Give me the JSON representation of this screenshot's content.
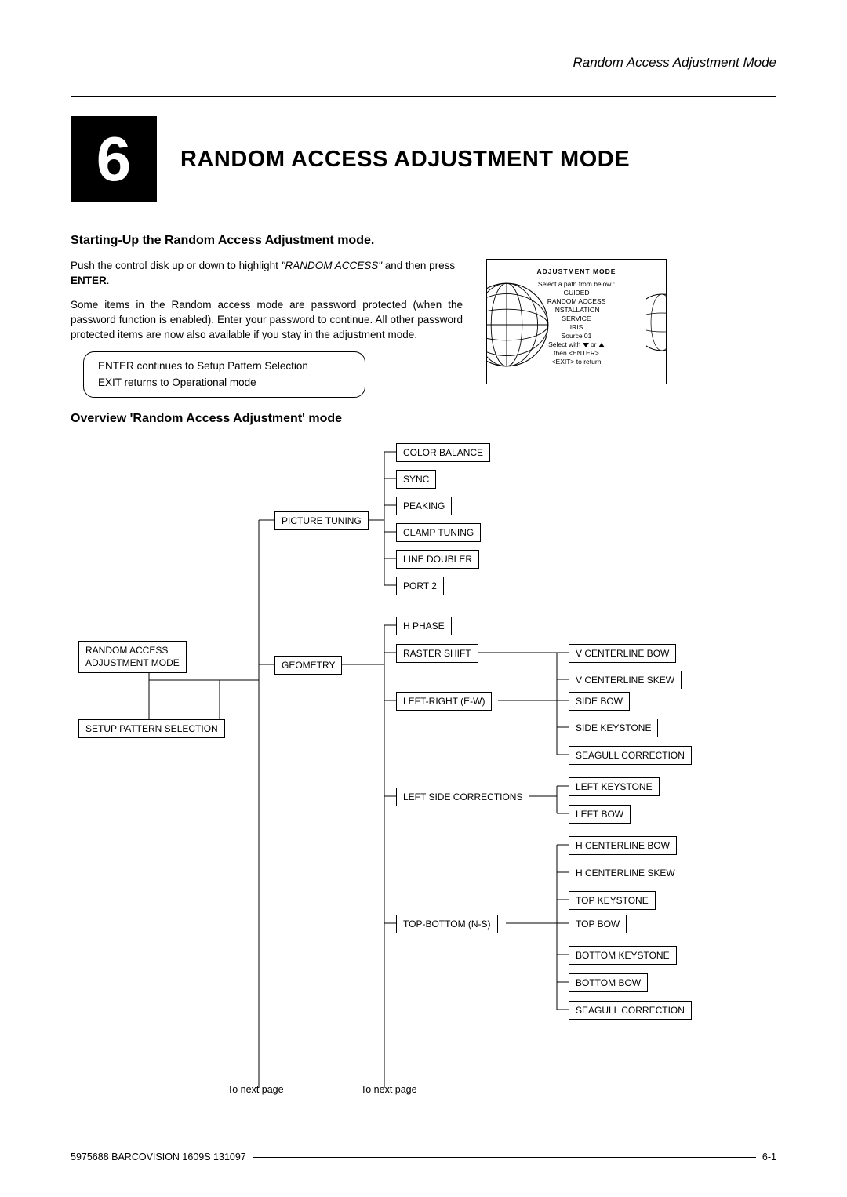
{
  "header": {
    "section": "Random Access Adjustment Mode"
  },
  "chapter": {
    "number": "6",
    "title": "RANDOM ACCESS ADJUSTMENT MODE"
  },
  "sections": {
    "start_h": "Starting-Up the Random Access Adjustment mode.",
    "overview_h": "Overview 'Random Access Adjustment' mode"
  },
  "body": {
    "p1a": "Push the control disk up or down to highlight ",
    "p1i": "\"RANDOM  ACCESS\"",
    "p1b": "  and then press ",
    "p1bold": "ENTER",
    "p1end": ".",
    "p2": "Some items in the Random access mode are password protected (when the password function is enabled).  Enter your password to continue.  All other password protected items are now also available if you stay in the adjustment mode."
  },
  "hint": {
    "l1b": "ENTER",
    "l1": " continues to Setup Pattern Selection",
    "l2b": "EXIT",
    "l2": " returns to Operational mode"
  },
  "screen": {
    "title": "ADJUSTMENT MODE",
    "sub": "Select  a  path  from  below :",
    "m1": "GUIDED",
    "m2": "RANDOM  ACCESS",
    "m3": "INSTALLATION",
    "m4": "SERVICE",
    "m5": "IRIS",
    "src": "Source  01",
    "sel_a": "Select with ",
    "sel_b": " or ",
    "then": "then  <ENTER>",
    "exit": "<EXIT>  to  return"
  },
  "diagram": {
    "root1": "RANDOM ACCESS",
    "root2": "ADJUSTMENT MODE",
    "setup": "SETUP PATTERN SELECTION",
    "pic": "PICTURE TUNING",
    "geo": "GEOMETRY",
    "pic_items": {
      "cb": "COLOR BALANCE",
      "sync": "SYNC",
      "peak": "PEAKING",
      "clamp": "CLAMP TUNING",
      "ld": "LINE DOUBLER",
      "p2": "PORT 2"
    },
    "geo_items": {
      "hp": "H PHASE",
      "rs": "RASTER SHIFT",
      "lr": "LEFT-RIGHT (E-W)",
      "lsc": "LEFT SIDE CORRECTIONS",
      "tb": "TOP-BOTTOM (N-S)"
    },
    "lr_items": {
      "vcb": "V CENTERLINE BOW",
      "vcs": "V CENTERLINE SKEW",
      "sb": "SIDE BOW",
      "sk": "SIDE KEYSTONE",
      "sc": "SEAGULL CORRECTION"
    },
    "lsc_items": {
      "lk": "LEFT KEYSTONE",
      "lb": "LEFT BOW"
    },
    "tb_items": {
      "hcb": "H CENTERLINE BOW",
      "hcs": "H CENTERLINE SKEW",
      "tk": "TOP KEYSTONE",
      "tbw": "TOP BOW",
      "bk": "BOTTOM KEYSTONE",
      "bb": "BOTTOM BOW",
      "sc2": "SEAGULL CORRECTION"
    },
    "next1": "To next page",
    "next2": "To next page"
  },
  "footer": {
    "left": "5975688 BARCOVISION 1609S 131097",
    "right": "6-1"
  }
}
